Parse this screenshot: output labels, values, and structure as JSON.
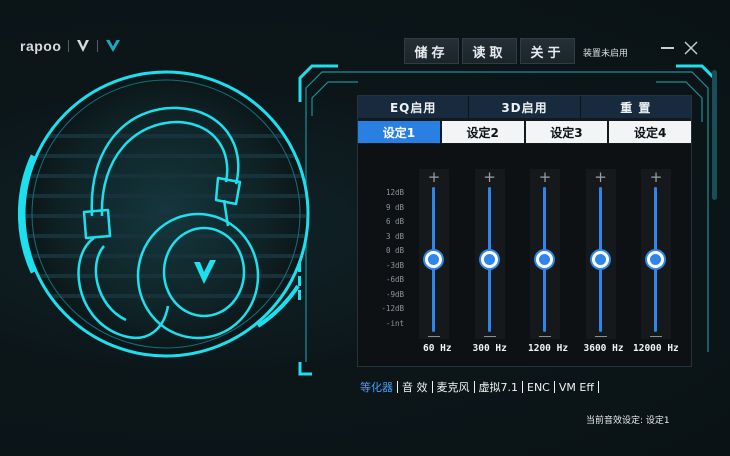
{
  "brand": {
    "name": "rapoo"
  },
  "toolbar": {
    "save": "储存",
    "load": "读取",
    "about": "关于"
  },
  "device_status": "装置未启用",
  "modes": [
    "EQ启用",
    "3D启用",
    "重 置"
  ],
  "presets": [
    "设定1",
    "设定2",
    "设定3",
    "设定4"
  ],
  "active_preset_index": 0,
  "db_scale": [
    "12dB",
    "9 dB",
    "6 dB",
    "3 dB",
    "0 dB",
    "-3dB",
    "-6dB",
    "-9dB",
    "-12dB",
    "-int"
  ],
  "bands": [
    {
      "freq": "60 Hz",
      "gain_db": 0
    },
    {
      "freq": "300 Hz",
      "gain_db": 0
    },
    {
      "freq": "1200 Hz",
      "gain_db": 0
    },
    {
      "freq": "3600 Hz",
      "gain_db": 0
    },
    {
      "freq": "12000 Hz",
      "gain_db": 0
    }
  ],
  "bottom_nav": [
    "等化器",
    "音 效",
    "麦克风",
    "虚拟7.1",
    "ENC",
    "VM Eff"
  ],
  "active_nav_index": 0,
  "current_preset_text": "当前音效设定: 设定1",
  "colors": {
    "accent": "#2a7fe2",
    "cyan": "#1ce0ee",
    "panel": "#121a1e"
  },
  "icons": {
    "minimize": "minimize-icon",
    "close": "close-icon",
    "headphone": "headphone-icon"
  }
}
